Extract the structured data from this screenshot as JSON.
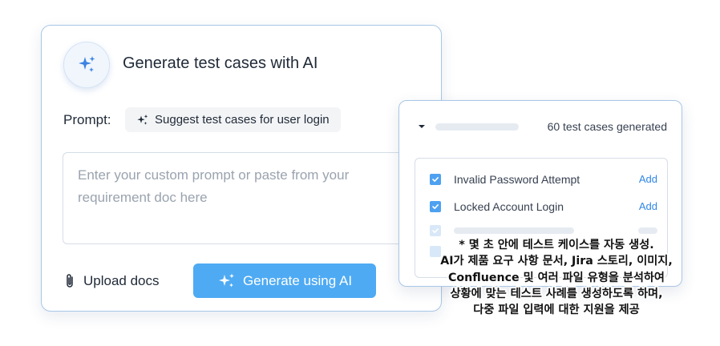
{
  "left_card": {
    "title": "Generate test cases with AI",
    "prompt_label": "Prompt:",
    "suggestion": "Suggest test cases for user login",
    "textarea_placeholder": "Enter your custom prompt or paste from your requirement doc here",
    "upload_label": "Upload docs",
    "generate_label": "Generate using AI"
  },
  "right_card": {
    "count_label": "60 test cases generated",
    "items": [
      {
        "label": "Invalid Password Attempt",
        "action": "Add",
        "checked": true
      },
      {
        "label": "Locked Account Login",
        "action": "Add",
        "checked": true
      }
    ]
  },
  "caption": {
    "lines": [
      "* 몇 초 안에 테스트 케이스를 자동 생성.",
      "AI가 제품 요구 사항 문서, Jira 스토리, 이미지,",
      "Confluence 및 여러 파일 유형을 분석하여",
      "상황에 맞는 테스트 사례를 생성하도록 하며,",
      "다중 파일 입력에 대한 지원을 제공"
    ]
  },
  "colors": {
    "accent": "#4eaaf3",
    "border": "#a9c6e6",
    "link": "#2f86e6"
  },
  "icons": [
    "sparkles-icon",
    "paperclip-icon",
    "caret-down-icon",
    "check-icon"
  ]
}
